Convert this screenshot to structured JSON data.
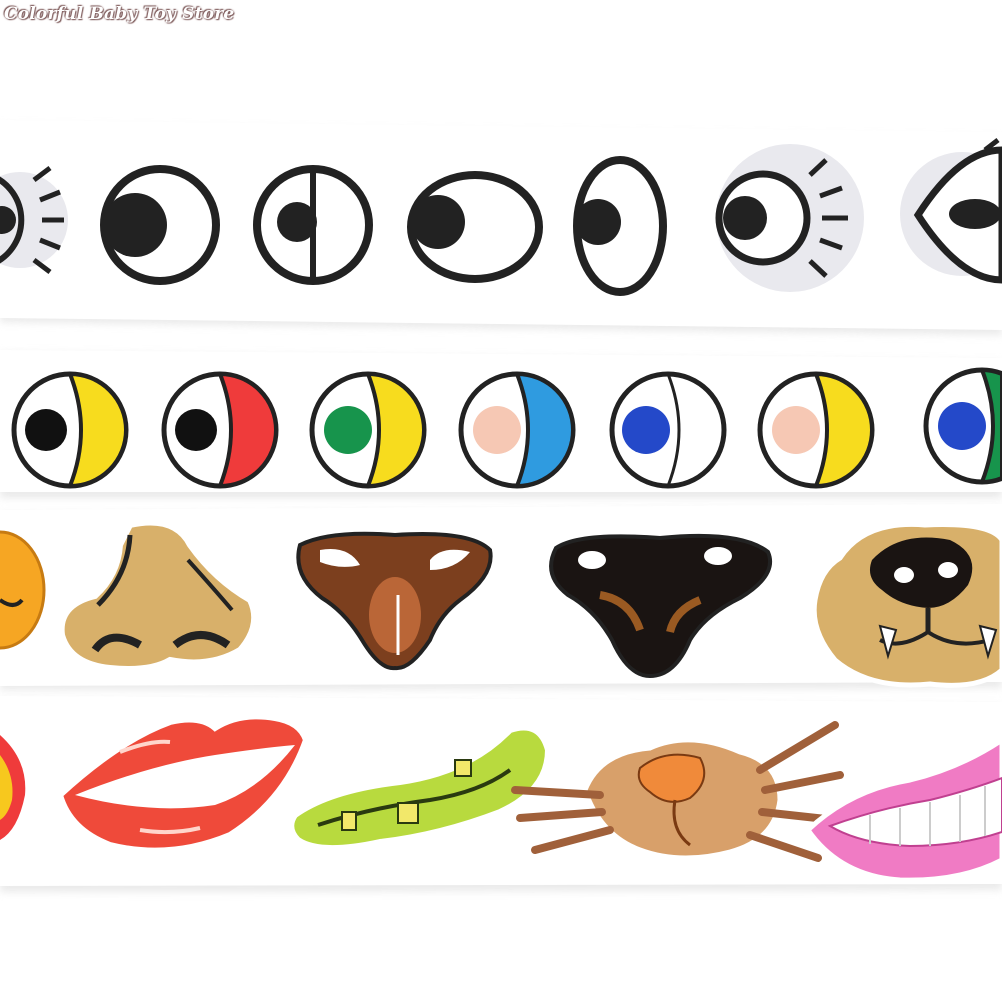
{
  "watermark": {
    "text": "Colorful Baby Toy Store"
  },
  "photo": {
    "subject": "rolls-of-face-stickers",
    "strips": [
      {
        "name": "googly-eyes-strip",
        "count": 7
      },
      {
        "name": "colored-eyes-strip",
        "count": 7
      },
      {
        "name": "noses-strip",
        "count": 5
      },
      {
        "name": "mouths-strip",
        "count": 5
      }
    ],
    "colors": {
      "yellow": "#f7dc1e",
      "red": "#ef3b3b",
      "green": "#17944c",
      "peach": "#f6c8b4",
      "blue": "#2f86d6",
      "navy": "#2449c9",
      "tan": "#d8b06a",
      "brown": "#7c3f1e",
      "lip-red": "#ef4a3a",
      "lime": "#b8da3e",
      "pink": "#f07bc4"
    }
  }
}
